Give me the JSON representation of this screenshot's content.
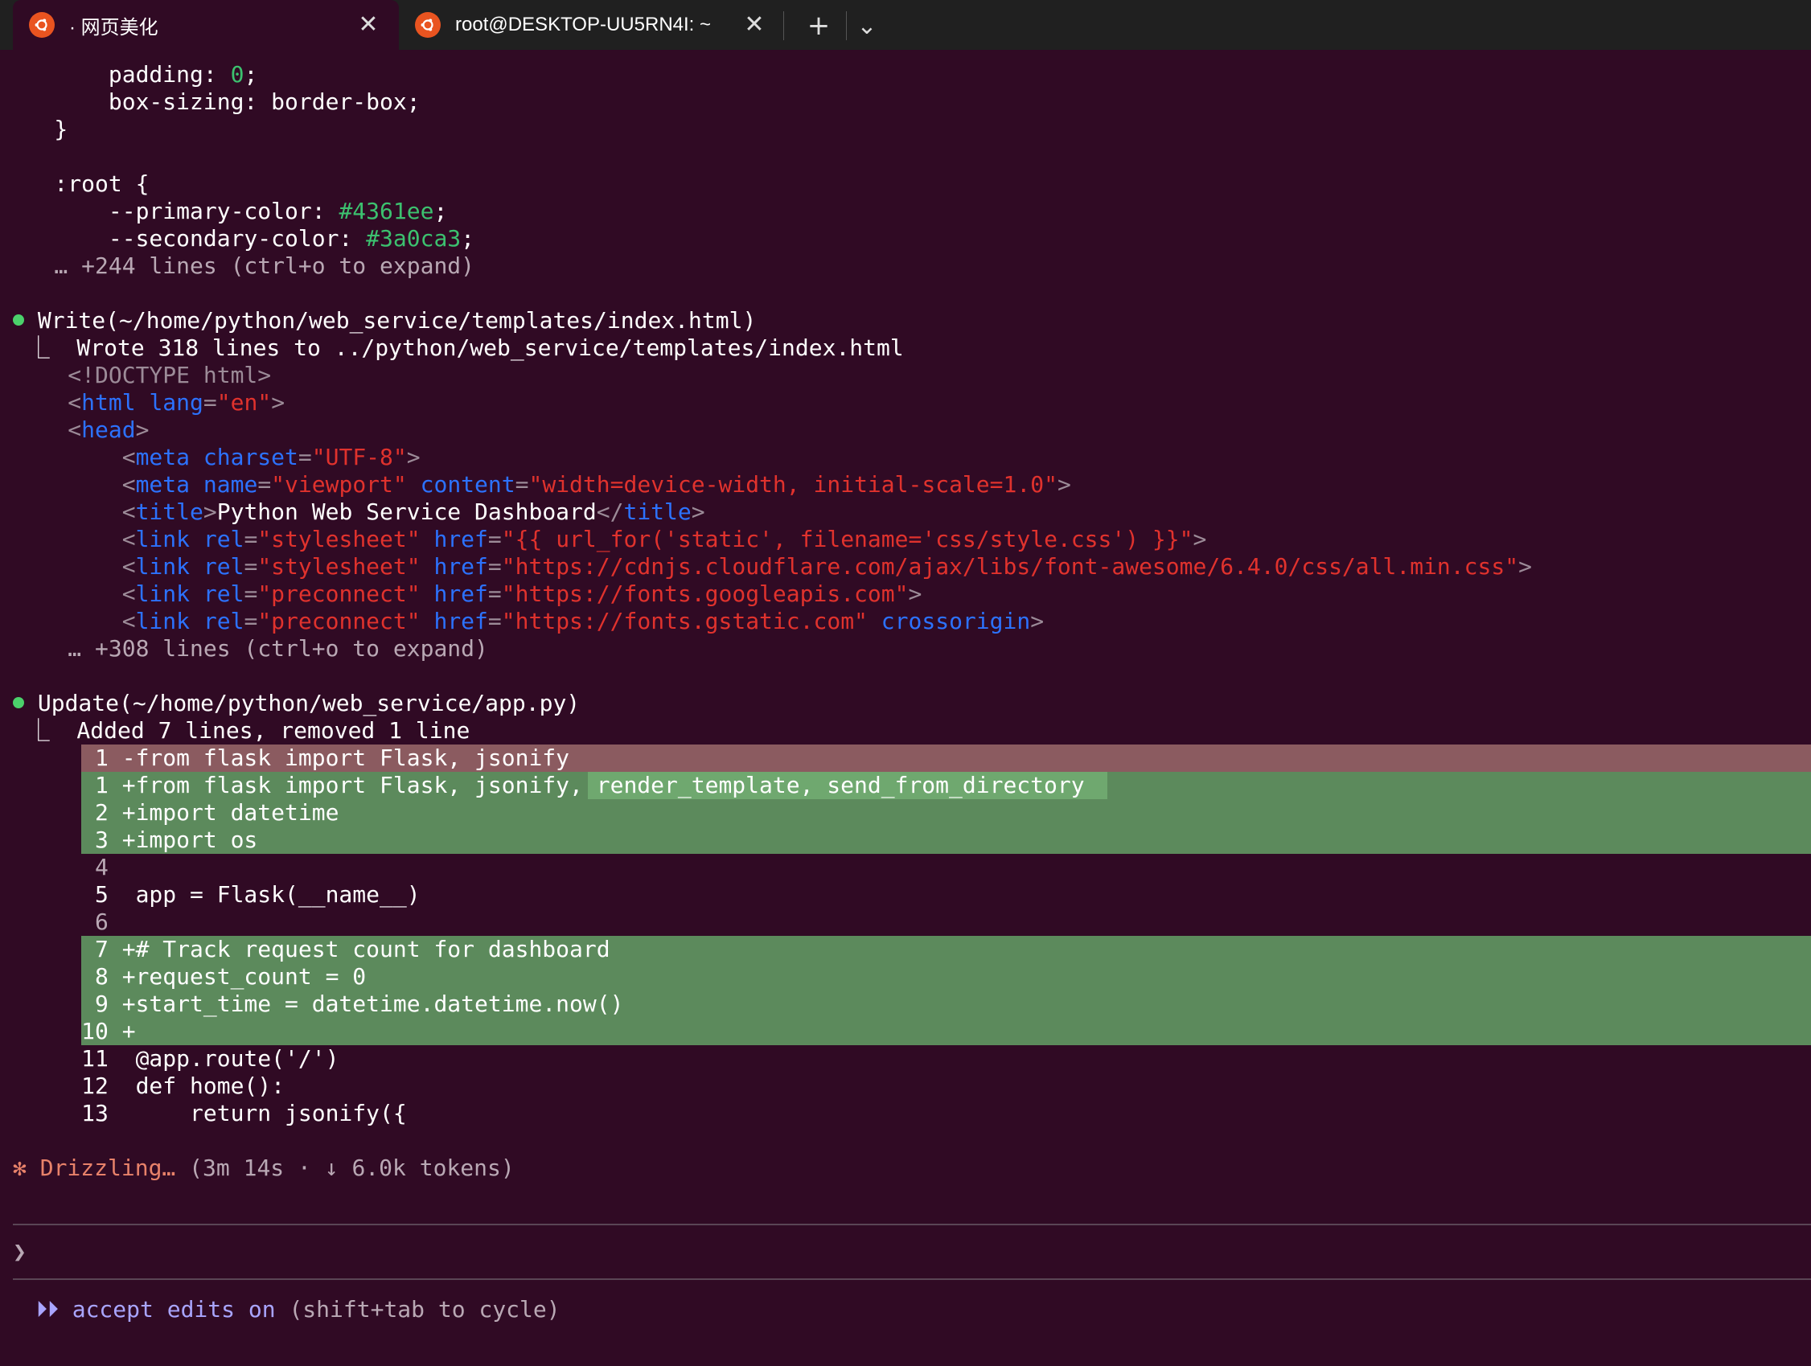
{
  "tabs": [
    {
      "label": "· 网页美化",
      "close": "✕",
      "active": true
    },
    {
      "label": "root@DESKTOP-UU5RN4I: ~",
      "close": "✕",
      "active": false
    }
  ],
  "tab_actions": {
    "new_tab": "+",
    "dropdown": "⌄"
  },
  "css_block": {
    "l1": {
      "prop": "        padding: ",
      "val": "0",
      "end": ";"
    },
    "l2": "        box-sizing: border-box;",
    "l3": "    }",
    "l4": "    :root {",
    "l5": {
      "prop": "        --primary-color: ",
      "val": "#4361ee",
      "end": ";"
    },
    "l6": {
      "prop": "        --secondary-color: ",
      "val": "#3a0ca3",
      "end": ";"
    },
    "l7": "    … +244 lines (ctrl+o to expand)"
  },
  "write_block": {
    "header": " Write(~/home/python/web_service/templates/index.html)",
    "result": "  ⎿  Wrote 318 lines to ../python/web_service/templates/index.html",
    "doctype": "     <!DOCTYPE html>",
    "html_open": {
      "pre": "     <",
      "tag": "html",
      "sp": " ",
      "attr": "lang",
      "eq": "=",
      "val": "\"en\"",
      "close": ">"
    },
    "head_open": {
      "pre": "     <",
      "tag": "head",
      "close": ">"
    },
    "meta1": {
      "pre": "         <",
      "tag": "meta",
      "sp": " ",
      "attr": "charset",
      "eq": "=",
      "val": "\"UTF-8\"",
      "close": ">"
    },
    "meta2": {
      "pre": "         <",
      "tag": "meta",
      "sp": " ",
      "a1": "name",
      "eq1": "=",
      "v1": "\"viewport\"",
      "sp2": " ",
      "a2": "content",
      "eq2": "=",
      "v2": "\"width=device-width, initial-scale=1.0\"",
      "close": ">"
    },
    "title": {
      "pre": "         <",
      "tag": "title",
      "gt": ">",
      "text": "Python Web Service Dashboard",
      "lt": "</",
      "tag2": "title",
      "close": ">"
    },
    "link1": {
      "pre": "         <",
      "tag": "link",
      "sp": " ",
      "a1": "rel",
      "eq1": "=",
      "v1": "\"stylesheet\"",
      "sp2": " ",
      "a2": "href",
      "eq2": "=",
      "v2": "\"{{ url_for('static', filename='css/style.css') }}\"",
      "close": ">"
    },
    "link2": {
      "pre": "         <",
      "tag": "link",
      "sp": " ",
      "a1": "rel",
      "eq1": "=",
      "v1": "\"stylesheet\"",
      "sp2": " ",
      "a2": "href",
      "eq2": "=",
      "v2": "\"https://cdnjs.cloudflare.com/ajax/libs/font-awesome/6.4.0/css/all.min.css\"",
      "close": ">"
    },
    "link3": {
      "pre": "         <",
      "tag": "link",
      "sp": " ",
      "a1": "rel",
      "eq1": "=",
      "v1": "\"preconnect\"",
      "sp2": " ",
      "a2": "href",
      "eq2": "=",
      "v2": "\"https://fonts.googleapis.com\"",
      "close": ">"
    },
    "link4": {
      "pre": "         <",
      "tag": "link",
      "sp": " ",
      "a1": "rel",
      "eq1": "=",
      "v1": "\"preconnect\"",
      "sp2": " ",
      "a2": "href",
      "eq2": "=",
      "v2": "\"https://fonts.gstatic.com\"",
      "sp3": " ",
      "a3": "crossorigin",
      "close": ">"
    },
    "more": "     … +308 lines (ctrl+o to expand)"
  },
  "update_block": {
    "header": " Update(~/home/python/web_service/app.py)",
    "result": "  ⎿  Added 7 lines, removed 1 line",
    "diff": {
      "d1": "       1 -from flask import Flask, jsonify",
      "a1_pre": "       1 +from flask import Flask, jsonify",
      "a1_hl": ", render_template, send_from_directory",
      "a2": "       2 +import datetime",
      "a3": "       3 +import os",
      "c4": "       4",
      "c5": "       5  app = Flask(__name__)",
      "c6": "       6",
      "a7": "       7 +# Track request count for dashboard",
      "a8": "       8 +request_count = 0",
      "a9": "       9 +start_time = datetime.datetime.now()",
      "a10": "      10 +",
      "c11": "      11  @app.route('/')",
      "c12": "      12  def home():",
      "c13": "      13      return jsonify({"
    }
  },
  "status": {
    "text": "✻ Drizzling… ",
    "meta": "(3m 14s · ↓ 6.0k tokens)"
  },
  "prompt": {
    "symbol": "❯"
  },
  "footer": {
    "icon": " ⏵⏵ ",
    "mode": "accept edits on",
    "hint": " (shift+tab to cycle)"
  }
}
